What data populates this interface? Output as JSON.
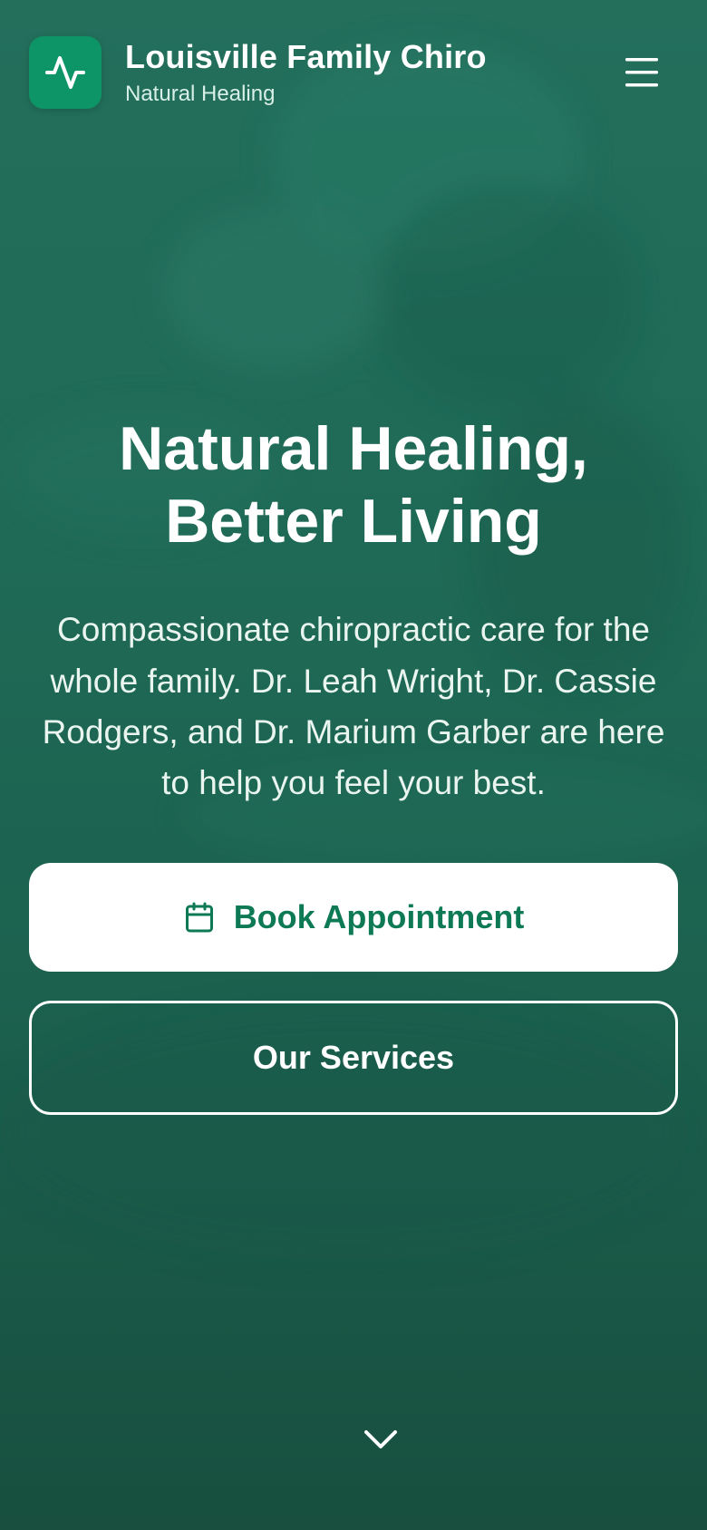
{
  "header": {
    "logo_icon": "activity-pulse-icon",
    "brand_name": "Louisville Family Chiro",
    "tagline": "Natural Healing",
    "menu_icon": "hamburger-menu-icon"
  },
  "hero": {
    "title_line1": "Natural Healing,",
    "title_line2": "Better Living",
    "description": "Compassionate chiropractic care for the whole family. Dr. Leah Wright, Dr. Cassie Rodgers, and Dr. Marium Garber are here to help you feel your best."
  },
  "actions": {
    "book_label": "Book Appointment",
    "book_icon": "calendar-icon",
    "services_label": "Our Services"
  },
  "scroll_indicator": {
    "icon": "chevron-down-icon"
  },
  "colors": {
    "brand_green": "#0d9467",
    "accent_text": "#0e7a55",
    "background": "#1f6a56"
  }
}
